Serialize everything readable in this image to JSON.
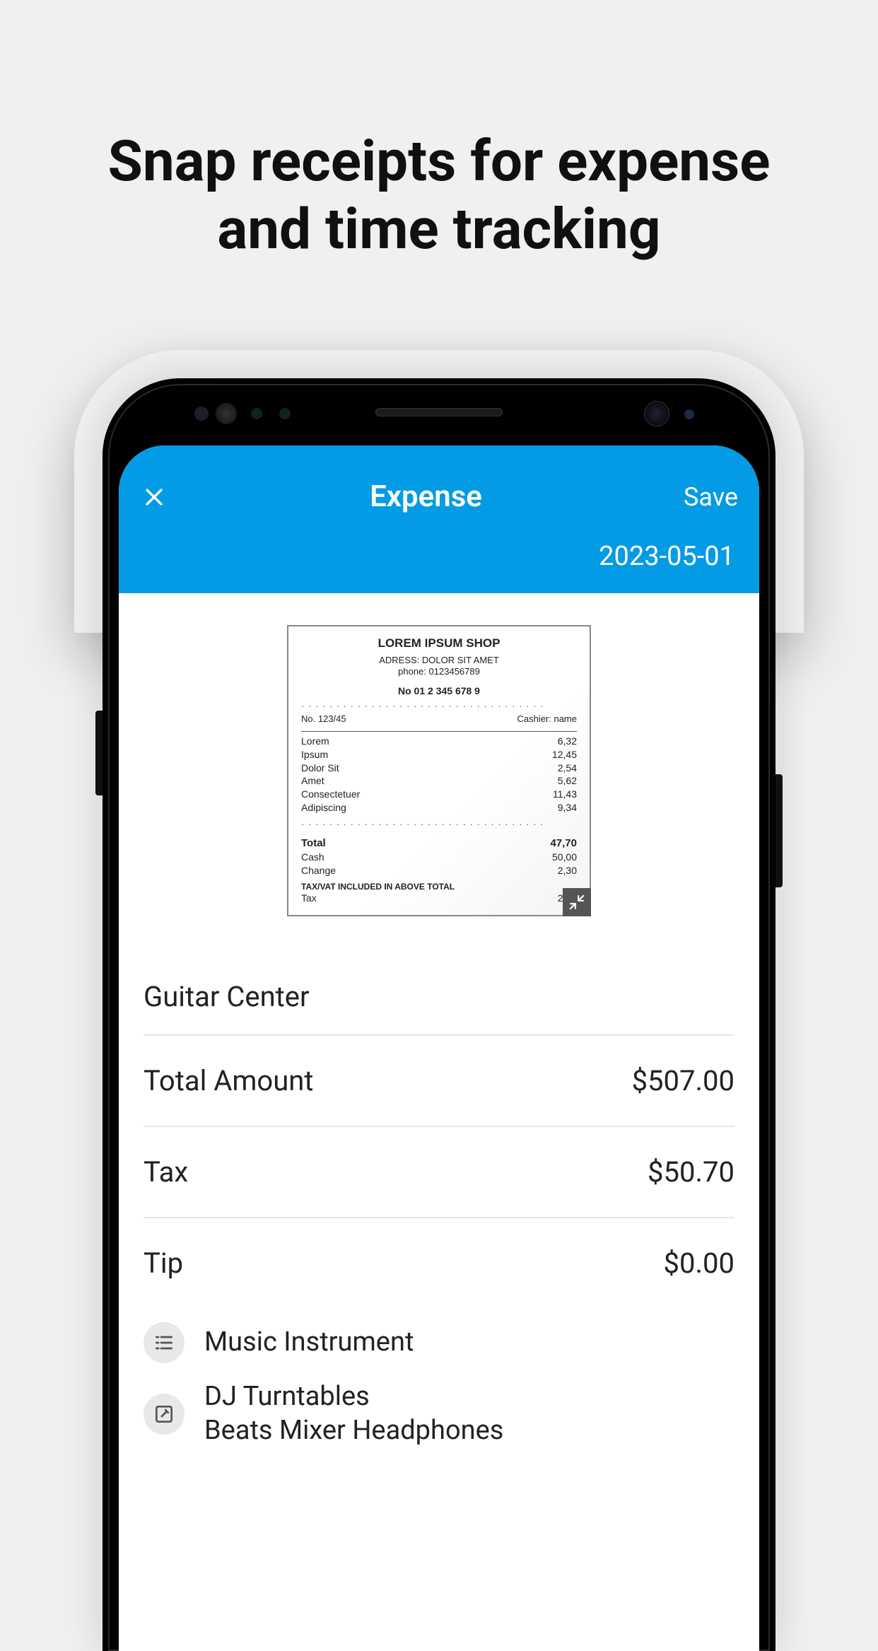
{
  "promo": {
    "headline_l1": "Snap receipts for expense",
    "headline_l2": "and time tracking"
  },
  "header": {
    "title": "Expense",
    "save_label": "Save",
    "date": "2023-05-01"
  },
  "receipt": {
    "shop_name": "LOREM IPSUM SHOP",
    "address_line": "ADRESS: DOLOR SIT AMET",
    "phone_line": "phone: 0123456789",
    "serial": "No 01 2 345 678 9",
    "order_no_label": "No. 123/45",
    "cashier_label": "Cashier: name",
    "items": [
      {
        "name": "Lorem",
        "price": "6,32"
      },
      {
        "name": "Ipsum",
        "price": "12,45"
      },
      {
        "name": "Dolor Sit",
        "price": "2,54"
      },
      {
        "name": "Amet",
        "price": "5,62"
      },
      {
        "name": "Consectetuer",
        "price": "11,43"
      },
      {
        "name": "Adipiscing",
        "price": "9,34"
      }
    ],
    "total_label": "Total",
    "total_value": "47,70",
    "cash_label": "Cash",
    "cash_value": "50,00",
    "change_label": "Change",
    "change_value": "2,30",
    "tax_note": "TAX/VAT INCLUDED IN ABOVE TOTAL",
    "tax_label": "Tax",
    "tax_value": "2,54"
  },
  "expense": {
    "vendor": "Guitar Center",
    "rows": [
      {
        "label": "Total Amount",
        "value": "$507.00"
      },
      {
        "label": "Tax",
        "value": "$50.70"
      },
      {
        "label": "Tip",
        "value": "$0.00"
      }
    ],
    "category": "Music Instrument",
    "description_l1": "DJ Turntables",
    "description_l2": "Beats Mixer Headphones"
  }
}
